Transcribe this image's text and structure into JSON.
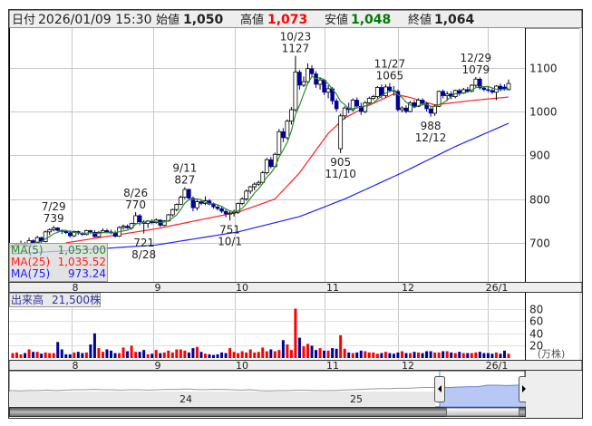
{
  "header": {
    "date_label": "日付",
    "datetime": "2026/01/09 15:30",
    "open_label": "始値",
    "open": "1,050",
    "high_label": "高値",
    "high": "1,073",
    "low_label": "安値",
    "low": "1,048",
    "close_label": "終値",
    "close": "1,064"
  },
  "legend": {
    "ma5_label": "MA(5)",
    "ma5_value": "1,053.00",
    "ma25_label": "MA(25)",
    "ma25_value": "1,035.52",
    "ma75_label": "MA(75)",
    "ma75_value": "973.24"
  },
  "volume_label": {
    "title": "出来高",
    "value": "21,500株"
  },
  "colors": {
    "up_volume": "#ff0000",
    "down_volume": "#000099",
    "flat_volume": "#888888",
    "ma5": "#2e8b2e",
    "ma25": "#ff2020",
    "ma75": "#2020ff",
    "high": "#ff0000",
    "low": "#007a00",
    "down_candle": "#000099"
  },
  "chart_data": {
    "type": "candlestick",
    "price_axis": {
      "ticks": [
        "1100",
        "1000",
        "900",
        "800",
        "700"
      ],
      "tick_values": [
        1100,
        1000,
        900,
        800,
        700
      ]
    },
    "month_labels": [
      "8",
      "9",
      "10",
      "11",
      "12",
      "26/1"
    ],
    "volume_axis": {
      "ticks": [
        "80",
        "60",
        "40",
        "20"
      ],
      "unit": "(万株)"
    },
    "ohlc": [
      [
        690,
        696,
        686,
        694
      ],
      [
        694,
        700,
        690,
        697
      ],
      [
        697,
        705,
        692,
        699
      ],
      [
        699,
        702,
        688,
        692
      ],
      [
        692,
        712,
        690,
        705
      ],
      [
        705,
        708,
        696,
        700
      ],
      [
        700,
        716,
        698,
        712
      ],
      [
        712,
        714,
        700,
        703
      ],
      [
        703,
        728,
        701,
        725
      ],
      [
        725,
        733,
        718,
        730
      ],
      [
        730,
        739,
        726,
        734
      ],
      [
        734,
        736,
        726,
        728
      ],
      [
        728,
        731,
        720,
        726
      ],
      [
        726,
        730,
        720,
        723
      ],
      [
        723,
        729,
        712,
        716
      ],
      [
        716,
        728,
        713,
        726
      ],
      [
        726,
        728,
        718,
        722
      ],
      [
        722,
        725,
        716,
        719
      ],
      [
        719,
        730,
        717,
        728
      ],
      [
        728,
        730,
        720,
        724
      ],
      [
        724,
        729,
        712,
        714
      ],
      [
        714,
        727,
        712,
        724
      ],
      [
        724,
        733,
        722,
        728
      ],
      [
        728,
        732,
        722,
        725
      ],
      [
        725,
        730,
        720,
        723
      ],
      [
        723,
        728,
        712,
        715
      ],
      [
        715,
        738,
        713,
        735
      ],
      [
        735,
        742,
        730,
        738
      ],
      [
        738,
        742,
        732,
        734
      ],
      [
        734,
        746,
        730,
        744
      ],
      [
        744,
        770,
        742,
        762
      ],
      [
        762,
        766,
        740,
        748
      ],
      [
        748,
        752,
        721,
        744
      ],
      [
        744,
        752,
        734,
        750
      ],
      [
        750,
        754,
        742,
        746
      ],
      [
        746,
        756,
        744,
        752
      ],
      [
        752,
        754,
        736,
        740
      ],
      [
        740,
        752,
        738,
        750
      ],
      [
        750,
        766,
        748,
        764
      ],
      [
        764,
        778,
        760,
        776
      ],
      [
        776,
        790,
        772,
        788
      ],
      [
        788,
        808,
        786,
        804
      ],
      [
        804,
        827,
        800,
        822
      ],
      [
        822,
        824,
        798,
        802
      ],
      [
        802,
        806,
        772,
        780
      ],
      [
        780,
        798,
        774,
        794
      ],
      [
        794,
        800,
        786,
        790
      ],
      [
        790,
        806,
        786,
        796
      ],
      [
        796,
        800,
        786,
        788
      ],
      [
        788,
        792,
        778,
        782
      ],
      [
        782,
        786,
        774,
        778
      ],
      [
        778,
        782,
        768,
        772
      ],
      [
        772,
        776,
        758,
        766
      ],
      [
        766,
        772,
        751,
        768
      ],
      [
        768,
        776,
        760,
        770
      ],
      [
        770,
        792,
        766,
        790
      ],
      [
        790,
        804,
        786,
        800
      ],
      [
        800,
        822,
        796,
        818
      ],
      [
        818,
        830,
        812,
        828
      ],
      [
        828,
        838,
        820,
        834
      ],
      [
        834,
        842,
        830,
        838
      ],
      [
        838,
        864,
        834,
        860
      ],
      [
        860,
        894,
        856,
        890
      ],
      [
        890,
        896,
        870,
        874
      ],
      [
        874,
        906,
        872,
        902
      ],
      [
        902,
        960,
        900,
        954
      ],
      [
        954,
        962,
        930,
        940
      ],
      [
        940,
        982,
        936,
        978
      ],
      [
        978,
        1010,
        970,
        1004
      ],
      [
        1004,
        1127,
        1000,
        1090
      ],
      [
        1090,
        1095,
        1050,
        1060
      ],
      [
        1060,
        1080,
        1056,
        1068
      ],
      [
        1068,
        1110,
        1064,
        1098
      ],
      [
        1098,
        1106,
        1080,
        1086
      ],
      [
        1086,
        1092,
        1054,
        1062
      ],
      [
        1062,
        1078,
        1050,
        1072
      ],
      [
        1072,
        1074,
        1038,
        1044
      ],
      [
        1044,
        1060,
        1030,
        1052
      ],
      [
        1052,
        1056,
        1016,
        1024
      ],
      [
        1024,
        1030,
        1000,
        1006
      ],
      [
        915,
        995,
        905,
        990
      ],
      [
        990,
        1012,
        982,
        1008
      ],
      [
        1008,
        1020,
        996,
        1004
      ],
      [
        1004,
        1030,
        1000,
        1026
      ],
      [
        1026,
        1032,
        1008,
        1012
      ],
      [
        1012,
        1020,
        992,
        1000
      ],
      [
        1000,
        1024,
        996,
        1020
      ],
      [
        1020,
        1034,
        1016,
        1030
      ],
      [
        1030,
        1038,
        1026,
        1034
      ],
      [
        1034,
        1058,
        1030,
        1055
      ],
      [
        1055,
        1062,
        1030,
        1036
      ],
      [
        1036,
        1062,
        1032,
        1056
      ],
      [
        1056,
        1065,
        1044,
        1048
      ],
      [
        1048,
        1058,
        1036,
        1046
      ],
      [
        1046,
        1050,
        1000,
        1004
      ],
      [
        1004,
        1012,
        998,
        1008
      ],
      [
        1008,
        1014,
        996,
        1000
      ],
      [
        1000,
        1024,
        998,
        1020
      ],
      [
        1020,
        1026,
        1008,
        1012
      ],
      [
        1012,
        1030,
        1010,
        1026
      ],
      [
        1026,
        1030,
        1014,
        1018
      ],
      [
        1018,
        1022,
        1000,
        1006
      ],
      [
        1006,
        1010,
        988,
        996
      ],
      [
        996,
        1016,
        990,
        1012
      ],
      [
        1012,
        1048,
        1010,
        1046
      ],
      [
        1046,
        1050,
        1030,
        1036
      ],
      [
        1036,
        1046,
        1024,
        1040
      ],
      [
        1040,
        1046,
        1028,
        1034
      ],
      [
        1034,
        1050,
        1030,
        1048
      ],
      [
        1048,
        1052,
        1036,
        1042
      ],
      [
        1042,
        1054,
        1040,
        1050
      ],
      [
        1050,
        1056,
        1044,
        1046
      ],
      [
        1046,
        1062,
        1044,
        1060
      ],
      [
        1060,
        1079,
        1056,
        1074
      ],
      [
        1074,
        1078,
        1050,
        1054
      ],
      [
        1054,
        1058,
        1046,
        1050
      ],
      [
        1050,
        1056,
        1044,
        1048
      ],
      [
        1048,
        1054,
        1040,
        1044
      ],
      [
        1044,
        1060,
        1026,
        1058
      ],
      [
        1058,
        1064,
        1046,
        1050
      ],
      [
        1056,
        1062,
        1048,
        1052
      ],
      [
        1050,
        1073,
        1048,
        1064
      ]
    ],
    "volume_10k_shares": [
      8,
      9,
      6,
      8,
      14,
      10,
      10,
      7,
      9,
      8,
      8,
      26,
      14,
      6,
      6,
      9,
      10,
      8,
      9,
      22,
      40,
      16,
      10,
      14,
      12,
      8,
      8,
      17,
      11,
      20,
      10,
      10,
      13,
      6,
      7,
      13,
      8,
      9,
      12,
      9,
      14,
      14,
      12,
      9,
      16,
      18,
      10,
      7,
      6,
      5,
      6,
      9,
      8,
      16,
      10,
      8,
      11,
      9,
      14,
      9,
      10,
      17,
      11,
      14,
      11,
      13,
      29,
      22,
      13,
      80,
      33,
      19,
      23,
      20,
      13,
      16,
      12,
      12,
      16,
      15,
      37,
      15,
      9,
      8,
      9,
      12,
      11,
      9,
      9,
      7,
      8,
      10,
      8,
      7,
      9,
      11,
      8,
      8,
      10,
      9,
      8,
      11,
      11,
      9,
      9,
      11,
      11,
      9,
      8,
      10,
      8,
      8,
      8,
      9,
      10,
      8,
      8,
      7,
      9,
      7,
      12,
      7
    ],
    "ma25_points": [
      [
        13,
        700
      ],
      [
        35,
        732
      ],
      [
        55,
        770
      ],
      [
        64,
        800
      ],
      [
        70,
        860
      ],
      [
        77,
        950
      ],
      [
        81,
        985
      ],
      [
        86,
        1010
      ],
      [
        93,
        1040
      ],
      [
        97,
        1032
      ],
      [
        103,
        1015
      ],
      [
        112,
        1025
      ],
      [
        121,
        1033
      ]
    ],
    "ma75_points": [
      [
        0,
        675
      ],
      [
        19,
        685
      ],
      [
        35,
        695
      ],
      [
        55,
        725
      ],
      [
        70,
        760
      ],
      [
        81,
        800
      ],
      [
        95,
        860
      ],
      [
        108,
        920
      ],
      [
        121,
        973
      ]
    ],
    "annotations": [
      {
        "index": 10,
        "date": "7/29",
        "value": "739",
        "pos": "above",
        "price": 739
      },
      {
        "index": 30,
        "date": "8/26",
        "value": "770",
        "pos": "above",
        "price": 770
      },
      {
        "index": 32,
        "date": "8/28",
        "value": "721",
        "pos": "below",
        "price": 721
      },
      {
        "index": 42,
        "date": "9/11",
        "value": "827",
        "pos": "above",
        "price": 827
      },
      {
        "index": 53,
        "date": "10/1",
        "value": "751",
        "pos": "below",
        "price": 751
      },
      {
        "index": 69,
        "date": "10/23",
        "value": "1127",
        "pos": "above",
        "price": 1127
      },
      {
        "index": 80,
        "date": "11/10",
        "value": "905",
        "pos": "below",
        "price": 905
      },
      {
        "index": 92,
        "date": "11/27",
        "value": "1065",
        "pos": "above",
        "price": 1065
      },
      {
        "index": 102,
        "date": "12/12",
        "value": "988",
        "pos": "below",
        "price": 988
      },
      {
        "index": 113,
        "date": "12/29",
        "value": "1079",
        "pos": "above",
        "price": 1079
      }
    ]
  },
  "navigator": {
    "year_labels": [
      "24",
      "25"
    ],
    "history": [
      52,
      53,
      52,
      52,
      51,
      52,
      51,
      50,
      50,
      49,
      50,
      50,
      51,
      50,
      50,
      51,
      50,
      49,
      49,
      48,
      49,
      50,
      49,
      49,
      50,
      51,
      50,
      52,
      53,
      52,
      52,
      51,
      51,
      52,
      52,
      52,
      51,
      50,
      49,
      48,
      47,
      47,
      46,
      46,
      45,
      44,
      44
    ],
    "selected": [
      44,
      44,
      43,
      42,
      42,
      38,
      38,
      39,
      38,
      38
    ]
  }
}
